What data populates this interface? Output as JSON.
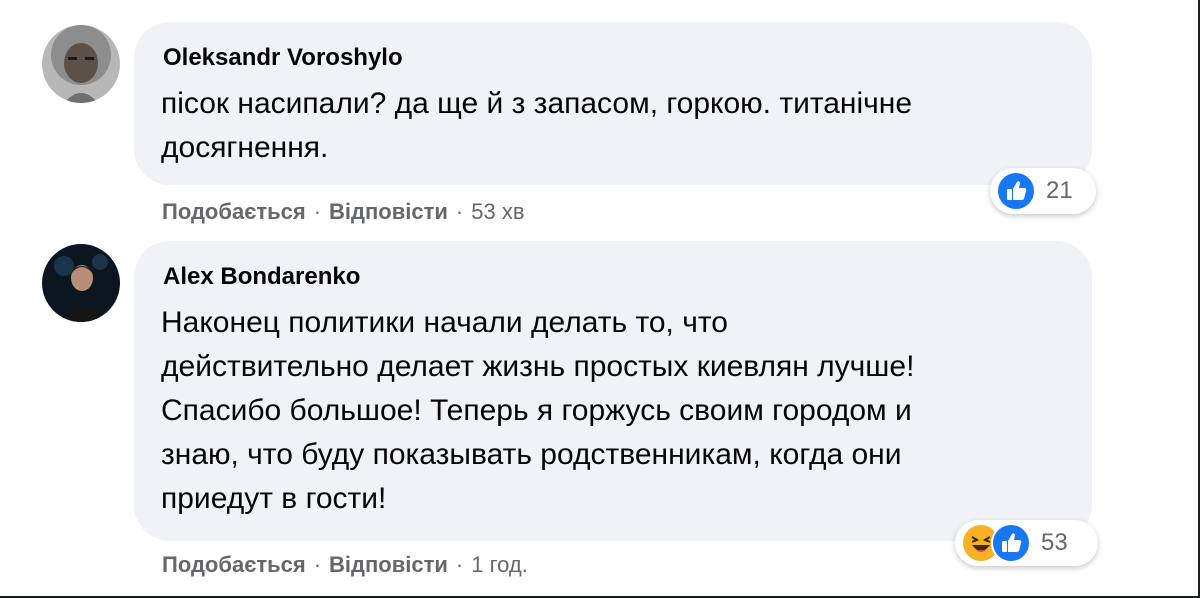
{
  "comments": [
    {
      "author": "Oleksandr Voroshylo",
      "text": "пісок насипали? да ще й з запасом, горкою. титанічне\nдосягнення.",
      "reactions": {
        "icons": [
          "like-icon"
        ],
        "count": "21"
      },
      "actions": {
        "like": "Подобається",
        "reply": "Відповісти",
        "separator": "·",
        "time": "53 хв"
      }
    },
    {
      "author": "Alex Bondarenko",
      "text": "Наконец политики начали делать то, что\nдействительно делает жизнь простых киевлян лучше!\nСпасибо большое! Теперь я горжусь своим городом и\nзнаю, что буду показывать родственникам, когда они\nприедут в гости!",
      "reactions": {
        "icons": [
          "haha-icon",
          "like-icon"
        ],
        "count": "53"
      },
      "actions": {
        "like": "Подобається",
        "reply": "Відповісти",
        "separator": "·",
        "time": "1 год."
      }
    }
  ],
  "colors": {
    "bubble_bg": "#f0f2f5",
    "secondary_text": "#65676b",
    "like_blue": "#1877f2",
    "haha_yellow": "#f7b125"
  }
}
